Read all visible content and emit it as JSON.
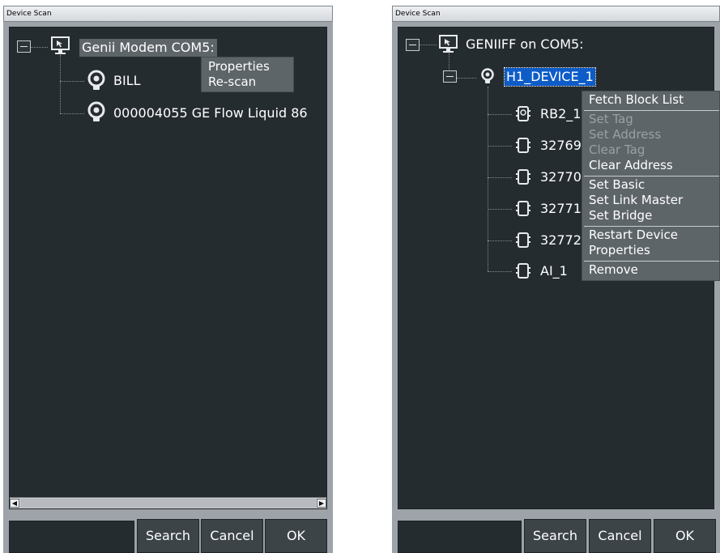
{
  "left_window": {
    "title": "Device Scan",
    "tree": {
      "root_label": "Genii Modem COM5:",
      "children": [
        "BILL",
        "000004055 GE Flow Liquid 86"
      ]
    },
    "context_menu": [
      "Properties",
      "Re-scan"
    ],
    "scrollbar": {
      "left_arrow": "◀",
      "right_arrow": "▶"
    },
    "buttons": {
      "search": "Search",
      "cancel": "Cancel",
      "ok": "OK"
    }
  },
  "right_window": {
    "title": "Device Scan",
    "tree": {
      "root_label": "GENIIFF on COM5:",
      "device_label": "H1_DEVICE_1",
      "blocks": [
        "RB2_1",
        "32769",
        "32770",
        "32771",
        "32772",
        "AI_1"
      ]
    },
    "context_menu": {
      "groups": [
        [
          {
            "label": "Fetch Block List",
            "enabled": true
          }
        ],
        [
          {
            "label": "Set Tag",
            "enabled": false
          },
          {
            "label": "Set Address",
            "enabled": false
          },
          {
            "label": "Clear Tag",
            "enabled": false
          },
          {
            "label": "Clear Address",
            "enabled": true
          }
        ],
        [
          {
            "label": "Set Basic",
            "enabled": true
          },
          {
            "label": "Set Link Master",
            "enabled": true
          },
          {
            "label": "Set Bridge",
            "enabled": true
          }
        ],
        [
          {
            "label": "Restart Device",
            "enabled": true
          },
          {
            "label": "Properties",
            "enabled": true
          }
        ],
        [
          {
            "label": "Remove",
            "enabled": true
          }
        ]
      ]
    },
    "buttons": {
      "search": "Search",
      "cancel": "Cancel",
      "ok": "OK"
    }
  },
  "colors": {
    "tree_background": "#252c30",
    "panel_frame": "#9da3a8",
    "menu_background": "#5e6569",
    "selection": "#0d5cc8"
  },
  "icons": [
    "monitor-icon",
    "device-bulb-icon",
    "block-icon"
  ]
}
